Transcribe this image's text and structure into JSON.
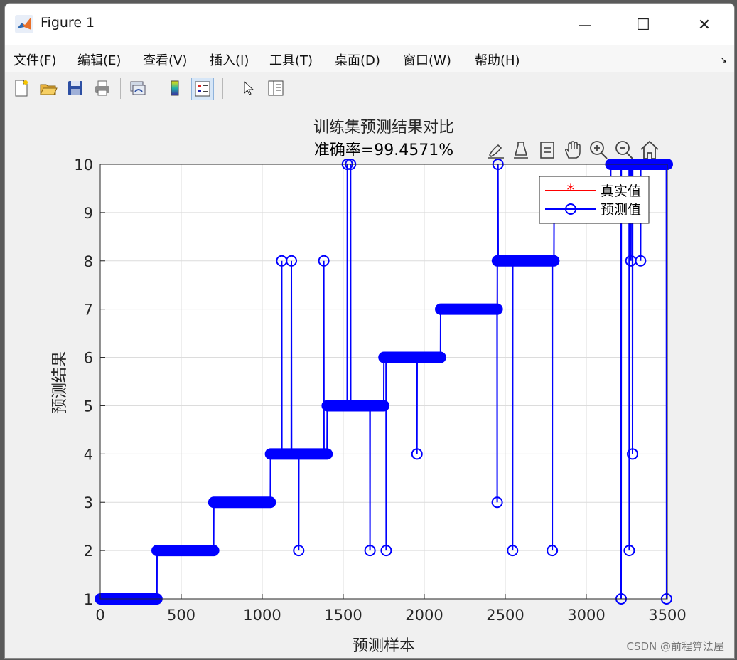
{
  "window": {
    "title": "Figure 1",
    "controls": {
      "minimize": "—",
      "maximize": "☐",
      "close": "✕"
    }
  },
  "menu": {
    "items": [
      "文件(F)",
      "编辑(E)",
      "查看(V)",
      "插入(I)",
      "工具(T)",
      "桌面(D)",
      "窗口(W)",
      "帮助(H)"
    ],
    "overflow": "↘"
  },
  "toolbar": {
    "icons": [
      "new-figure-icon",
      "open-file-icon",
      "save-icon",
      "print-icon",
      "link-plot-icon",
      "colorbar-icon",
      "legend-icon",
      "pointer-icon",
      "property-inspector-icon"
    ]
  },
  "axes_toolbar": {
    "icons": [
      "brush-icon",
      "data-tips-icon",
      "data-cursor-icon",
      "pan-icon",
      "zoom-in-icon",
      "zoom-out-icon",
      "home-icon"
    ]
  },
  "colors": {
    "series_true": "#ff0000",
    "series_pred": "#0000ff",
    "axes_bg": "#ffffff",
    "grid": "#dcdcdc"
  },
  "watermark": "CSDN @前程算法屋",
  "chart_data": {
    "type": "line",
    "title": "训练集预测结果对比",
    "subtitle": "准确率=99.4571%",
    "xlabel": "预测样本",
    "ylabel": "预测结果",
    "xlim": [
      0,
      3500
    ],
    "ylim": [
      1,
      10
    ],
    "xticks": [
      0,
      500,
      1000,
      1500,
      2000,
      2500,
      3000,
      3500
    ],
    "yticks": [
      1,
      2,
      3,
      4,
      5,
      6,
      7,
      8,
      9,
      10
    ],
    "grid": true,
    "legend_position": "top-right",
    "class_steps": [
      {
        "label": 1,
        "start": 1,
        "end": 350
      },
      {
        "label": 2,
        "start": 351,
        "end": 700
      },
      {
        "label": 3,
        "start": 701,
        "end": 1050
      },
      {
        "label": 4,
        "start": 1051,
        "end": 1400
      },
      {
        "label": 5,
        "start": 1401,
        "end": 1750
      },
      {
        "label": 6,
        "start": 1751,
        "end": 2100
      },
      {
        "label": 7,
        "start": 2101,
        "end": 2450
      },
      {
        "label": 8,
        "start": 2451,
        "end": 2800
      },
      {
        "label": 9,
        "start": 2801,
        "end": 3150
      },
      {
        "label": 10,
        "start": 3151,
        "end": 3500
      }
    ],
    "misclassified": [
      {
        "x": 1120,
        "y": 8
      },
      {
        "x": 1180,
        "y": 8
      },
      {
        "x": 1225,
        "y": 2
      },
      {
        "x": 1380,
        "y": 8
      },
      {
        "x": 1525,
        "y": 10
      },
      {
        "x": 1545,
        "y": 10
      },
      {
        "x": 1665,
        "y": 2
      },
      {
        "x": 1765,
        "y": 2
      },
      {
        "x": 1955,
        "y": 4
      },
      {
        "x": 2450,
        "y": 3
      },
      {
        "x": 2455,
        "y": 10
      },
      {
        "x": 2545,
        "y": 2
      },
      {
        "x": 2790,
        "y": 2
      },
      {
        "x": 3215,
        "y": 1
      },
      {
        "x": 3265,
        "y": 2
      },
      {
        "x": 3275,
        "y": 8
      },
      {
        "x": 3285,
        "y": 4
      },
      {
        "x": 3335,
        "y": 8
      },
      {
        "x": 3495,
        "y": 1
      }
    ],
    "series": [
      {
        "name": "真实值",
        "marker": "*",
        "color": "#ff0000"
      },
      {
        "name": "预测值",
        "marker": "o",
        "color": "#0000ff"
      }
    ]
  }
}
